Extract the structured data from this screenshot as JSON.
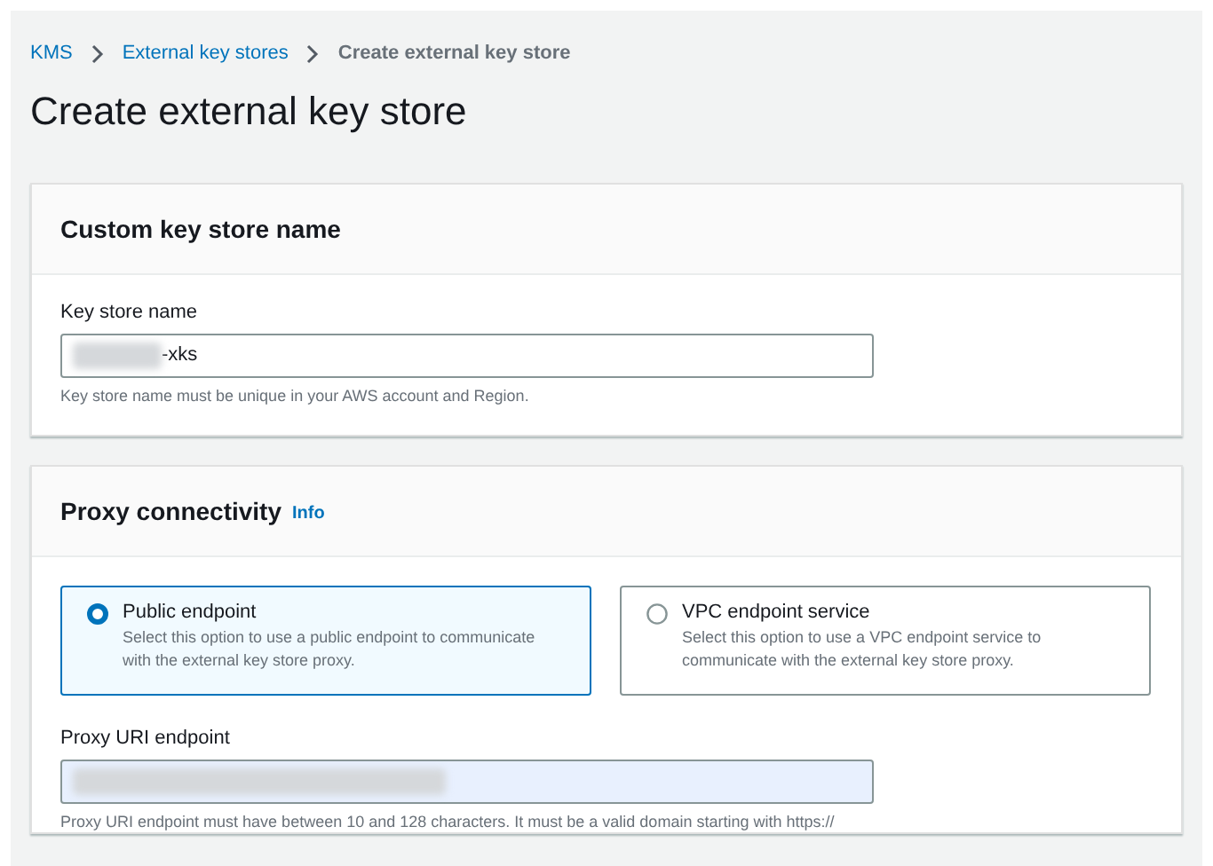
{
  "breadcrumbs": [
    {
      "label": "KMS",
      "kind": "link"
    },
    {
      "label": "External key stores",
      "kind": "link"
    },
    {
      "label": "Create external key store",
      "kind": "current"
    }
  ],
  "title": "Create external key store",
  "name_section": {
    "heading": "Custom key store name",
    "field": {
      "label": "Key store name",
      "value": "-xks",
      "redacted": true,
      "hint": "Key store name must be unique in your AWS account and Region."
    }
  },
  "proxy_section": {
    "heading": "Proxy connectivity",
    "info": "Info",
    "options": [
      {
        "label": "Public endpoint",
        "description": "Select this option to use a public endpoint to communicate with the external key store proxy.",
        "selected": true
      },
      {
        "label": "VPC endpoint service",
        "description": "Select this option to use a VPC endpoint service to communicate with the external key store proxy.",
        "selected": false
      }
    ],
    "field": {
      "label": "Proxy URI endpoint",
      "redacted": true,
      "autofilled": true,
      "hint": "Proxy URI endpoint must have between 10 and 128 characters. It must be a valid domain starting with https://"
    }
  }
}
